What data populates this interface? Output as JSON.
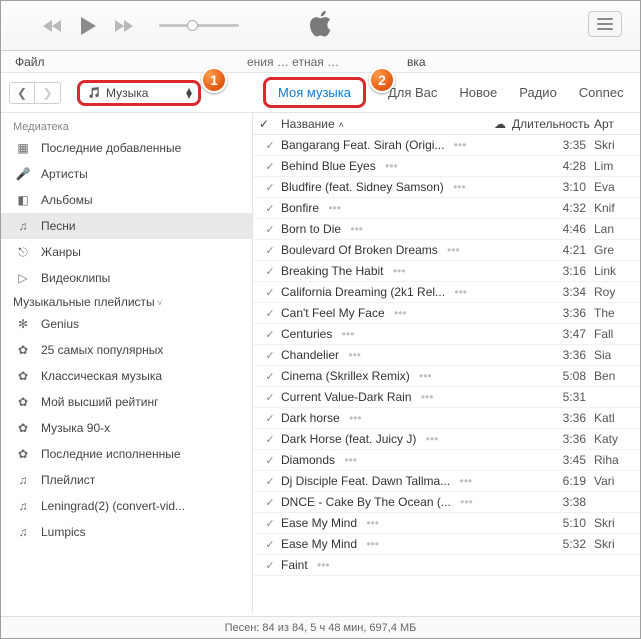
{
  "menubar": {
    "file": "Файл",
    "truncated": "ения  … етная … ",
    "suffix": "вка"
  },
  "media_picker": {
    "label": "Музыка"
  },
  "tabs": {
    "my_music": "Моя музыка",
    "for_you": "Для Вас",
    "new": "Новое",
    "radio": "Радио",
    "connect": "Connec"
  },
  "callouts": {
    "one": "1",
    "two": "2"
  },
  "sidebar": {
    "sections": {
      "library": "Медиатека",
      "playlists": "Музыкальные плейлисты"
    },
    "library": [
      {
        "label": "Последние добавленные"
      },
      {
        "label": "Артисты"
      },
      {
        "label": "Альбомы"
      },
      {
        "label": "Песни",
        "selected": true
      },
      {
        "label": "Жанры"
      },
      {
        "label": "Видеоклипы"
      }
    ],
    "playlists": [
      {
        "label": "Genius"
      },
      {
        "label": "25 самых популярных"
      },
      {
        "label": "Классическая музыка"
      },
      {
        "label": "Мой высший рейтинг"
      },
      {
        "label": "Музыка 90-х"
      },
      {
        "label": "Последние исполненные"
      },
      {
        "label": "Плейлист"
      },
      {
        "label": "Leningrad(2) (convert-vid..."
      },
      {
        "label": "Lumpics"
      }
    ]
  },
  "columns": {
    "name": "Название",
    "duration": "Длительность",
    "artist": "Арт"
  },
  "songs": [
    {
      "title": "Bangarang Feat. Sirah (Origi...",
      "dur": "3:35",
      "artist": "Skri"
    },
    {
      "title": "Behind Blue Eyes",
      "dur": "4:28",
      "artist": "Lim"
    },
    {
      "title": "Bludfire (feat. Sidney Samson)",
      "dur": "3:10",
      "artist": "Eva"
    },
    {
      "title": "Bonfire",
      "dur": "4:32",
      "artist": "Knif"
    },
    {
      "title": "Born to Die",
      "dur": "4:46",
      "artist": "Lan"
    },
    {
      "title": "Boulevard Of Broken Dreams",
      "dur": "4:21",
      "artist": "Gre"
    },
    {
      "title": "Breaking The Habit",
      "dur": "3:16",
      "artist": "Link"
    },
    {
      "title": "California Dreaming (2k1 Rel...",
      "dur": "3:34",
      "artist": "Roy"
    },
    {
      "title": "Can't Feel My Face",
      "dur": "3:36",
      "artist": "The"
    },
    {
      "title": "Centuries",
      "dur": "3:47",
      "artist": "Fall"
    },
    {
      "title": "Chandelier",
      "dur": "3:36",
      "artist": "Sia"
    },
    {
      "title": "Cinema (Skrillex Remix)",
      "dur": "5:08",
      "artist": "Ben"
    },
    {
      "title": "Current Value-Dark Rain",
      "dur": "5:31",
      "artist": ""
    },
    {
      "title": "Dark horse",
      "dur": "3:36",
      "artist": "Katl"
    },
    {
      "title": "Dark Horse (feat. Juicy J)",
      "dur": "3:36",
      "artist": "Katy"
    },
    {
      "title": "Diamonds",
      "dur": "3:45",
      "artist": "Riha"
    },
    {
      "title": "Dj Disciple Feat. Dawn Tallma...",
      "dur": "6:19",
      "artist": "Vari"
    },
    {
      "title": "DNCE - Cake By The Ocean (...",
      "dur": "3:38",
      "artist": ""
    },
    {
      "title": "Ease My Mind",
      "dur": "5:10",
      "artist": "Skri"
    },
    {
      "title": "Ease My Mind",
      "dur": "5:32",
      "artist": "Skri"
    },
    {
      "title": "Faint",
      "dur": "",
      "artist": ""
    }
  ],
  "status": "Песен: 84 из 84, 5 ч 48 мин, 697,4 МБ"
}
